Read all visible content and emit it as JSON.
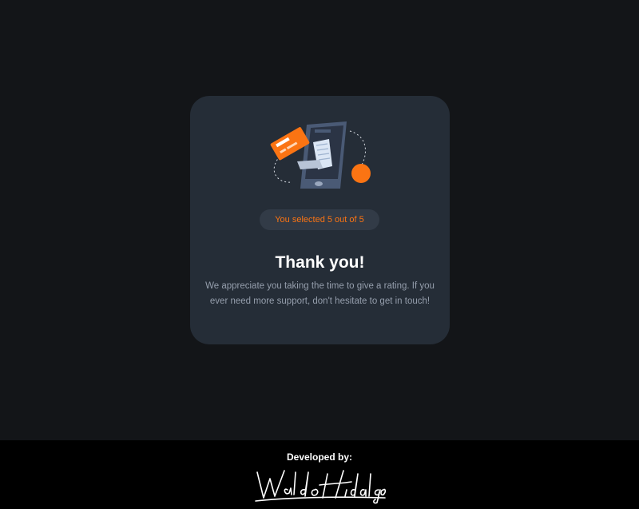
{
  "card": {
    "selection_text": "You selected 5 out of 5",
    "title": "Thank you!",
    "message": "We appreciate you taking the time to give a rating. If you ever need more support, don't hesitate to get in touch!"
  },
  "footer": {
    "label": "Developed by:",
    "signature": "Waldo Hidalgo"
  },
  "colors": {
    "background": "#131518",
    "card": "#252d37",
    "accent": "#fb7413",
    "pill": "#323b47",
    "text_muted": "#959eac",
    "footer": "#000000"
  },
  "icons": [
    "thank-you-illustration-icon"
  ]
}
